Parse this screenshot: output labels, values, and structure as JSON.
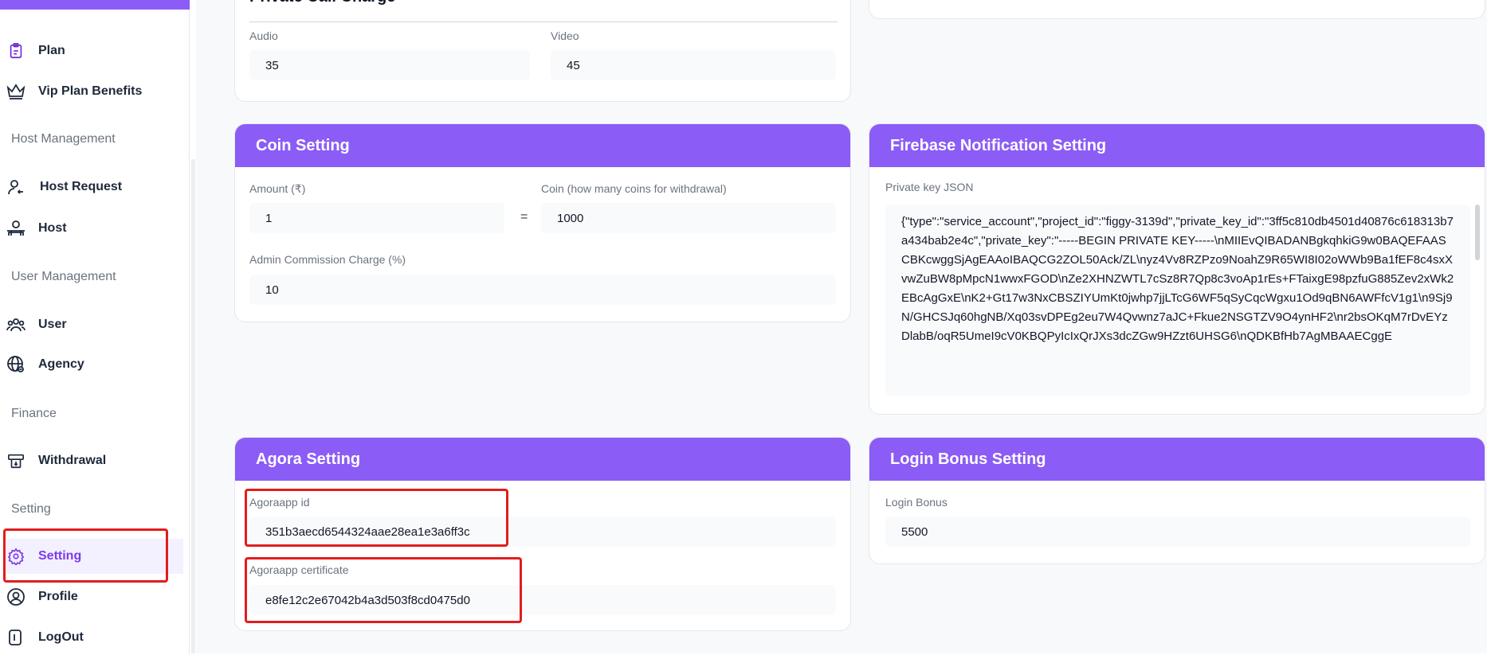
{
  "sidebar": {
    "items": [
      {
        "label": "Plan",
        "icon": "clipboard-icon"
      },
      {
        "label": "Vip Plan Benefits",
        "icon": "crown-icon"
      },
      {
        "label": "Host Request",
        "icon": "user-request-icon"
      },
      {
        "label": "Host",
        "icon": "host-icon"
      },
      {
        "label": "User",
        "icon": "users-icon"
      },
      {
        "label": "Agency",
        "icon": "globe-icon"
      },
      {
        "label": "Withdrawal",
        "icon": "withdrawal-icon"
      },
      {
        "label": "Setting",
        "icon": "gear-icon"
      },
      {
        "label": "Profile",
        "icon": "profile-icon"
      },
      {
        "label": "LogOut",
        "icon": "logout-icon"
      }
    ],
    "sections": {
      "host_management": "Host Management",
      "user_management": "User Management",
      "finance": "Finance",
      "setting": "Setting"
    }
  },
  "private_call": {
    "title": "Private Call Charge",
    "audio_label": "Audio",
    "audio_value": "35",
    "video_label": "Video",
    "video_value": "45"
  },
  "coin_setting": {
    "title": "Coin Setting",
    "amount_label": "Amount (₹)",
    "amount_value": "1",
    "equals": "=",
    "coin_label": "Coin (how many coins for withdrawal)",
    "coin_value": "1000",
    "commission_label": "Admin Commission Charge (%)",
    "commission_value": "10"
  },
  "firebase": {
    "title": "Firebase Notification Setting",
    "key_label": "Private key JSON",
    "key_value": "{\"type\":\"service_account\",\"project_id\":\"figgy-3139d\",\"private_key_id\":\"3ff5c810db4501d40876c618313b7a434bab2e4c\",\"private_key\":\"-----BEGIN PRIVATE KEY-----\\nMIIEvQIBADANBgkqhkiG9w0BAQEFAASCBKcwggSjAgEAAoIBAQCG2ZOL50Ack/ZL\\nyz4Vv8RZPzo9NoahZ9R65WI8I02oWWb9Ba1fEF8c4sxXvwZuBW8pMpcN1wwxFGOD\\nZe2XHNZWTL7cSz8R7Qp8c3voAp1rEs+FTaixgE98pzfuG885Zev2xWk2EBcAgGxE\\nK2+Gt17w3NxCBSZIYUmKt0jwhp7jjLTcG6WF5qSyCqcWgxu1Od9qBN6AWFfcV1g1\\n9Sj9N/GHCSJq60hgNB/Xq03svDPEg2eu7W4Qvwnz7aJC+Fkue2NSGTZV9O4ynHF2\\nr2bsOKqM7rDvEYzDlabB/oqR5UmeI9cV0KBQPyIcIxQrJXs3dcZGw9HZzt6UHSG6\\nQDKBfHb7AgMBAAECggE"
  },
  "agora": {
    "title": "Agora Setting",
    "app_id_label": "Agoraapp id",
    "app_id_value": "351b3aecd6544324aae28ea1e3a6ff3c",
    "cert_label": "Agoraapp certificate",
    "cert_value": "e8fe12c2e67042b4a3d503f8cd0475d0"
  },
  "login_bonus": {
    "title": "Login Bonus Setting",
    "bonus_label": "Login Bonus",
    "bonus_value": "5500"
  },
  "colors": {
    "accent": "#8b5cf6",
    "highlight": "#e11d1d"
  }
}
